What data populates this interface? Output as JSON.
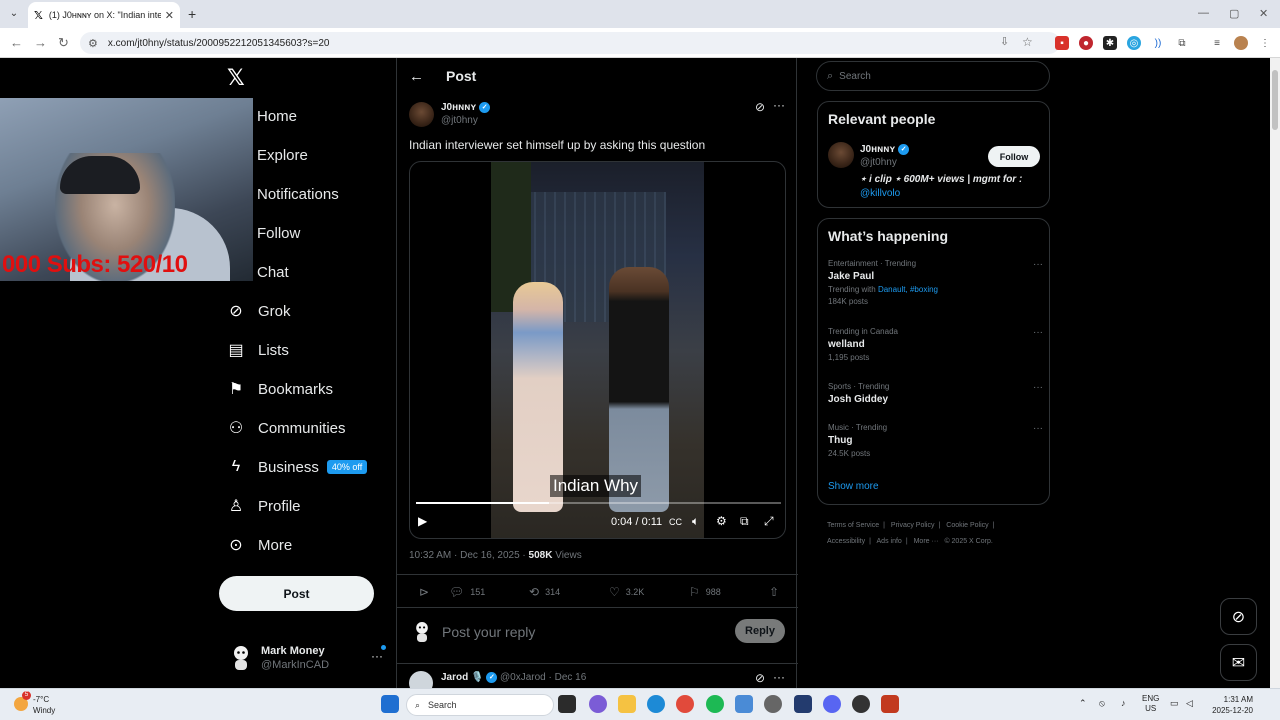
{
  "browser": {
    "tab_title": "(1) J0ʜɴɴʏ on X: \"Indian intervi",
    "tab_logo": "𝕏",
    "url": "x.com/jt0hny/status/2000952212051345603?s=20"
  },
  "webcam": {
    "overlay_text": "000 Subs: 520/10"
  },
  "nav": {
    "logo": "𝕏",
    "items": [
      {
        "label": "Home",
        "icon": ""
      },
      {
        "label": "Explore",
        "icon": ""
      },
      {
        "label": "Notifications",
        "icon": ""
      },
      {
        "label": "Follow",
        "icon": ""
      },
      {
        "label": "Chat",
        "icon": ""
      },
      {
        "label": "Grok",
        "icon": "grok-icon"
      },
      {
        "label": "Lists",
        "icon": "list-icon"
      },
      {
        "label": "Bookmarks",
        "icon": "bookmark-icon"
      },
      {
        "label": "Communities",
        "icon": "people-icon"
      },
      {
        "label": "Business",
        "icon": "lightning-icon"
      },
      {
        "label": "Profile",
        "icon": "person-icon"
      },
      {
        "label": "More",
        "icon": "more-circle-icon"
      }
    ],
    "business_badge": "40% off",
    "post_button": "Post"
  },
  "account": {
    "name": "Mark Money",
    "handle": "@MarkInCAD"
  },
  "post": {
    "header_title": "Post",
    "author_name": "J0ʜɴɴʏ",
    "author_handle": "@jt0hny",
    "text": "Indian interviewer set himself up by asking this question",
    "video": {
      "caption": "Indian Why",
      "time": "0:04 / 0:11",
      "progress": 0.364
    },
    "timestamp": "10:32 AM · Dec 16, 2025 · ",
    "views_count": "508K",
    "views_label": " Views",
    "stats": {
      "replies": "151",
      "reposts": "314",
      "likes": "3.2K",
      "bookmarks": "988"
    },
    "reply_placeholder": "Post your reply",
    "reply_button": "Reply"
  },
  "next_reply": {
    "name": "Jarod 🎙️",
    "handle": "@0xJarod · Dec 16"
  },
  "search": {
    "placeholder": "Search"
  },
  "relevant_people": {
    "title": "Relevant people",
    "name": "J0ʜɴɴʏ",
    "handle": "@jt0hny",
    "follow_label": "Follow",
    "bio": "⋆ i clip ⋆ 600M+ views | mgmt for :",
    "bio_link": "@killvolo"
  },
  "trending": {
    "title": "What’s happening",
    "items": [
      {
        "category": "Entertainment · Trending",
        "topic": "Jake Paul",
        "sub_prefix": "Trending with ",
        "sub_links": "Danault, #boxing",
        "posts": "184K posts"
      },
      {
        "category": "Trending in Canada",
        "topic": "welland",
        "posts": "1,195 posts"
      },
      {
        "category": "Sports · Trending",
        "topic": "Josh Giddey",
        "posts": ""
      },
      {
        "category": "Music · Trending",
        "topic": "Thug",
        "posts": "24.5K posts"
      }
    ],
    "show_more": "Show more"
  },
  "footer": {
    "links": [
      "Terms of Service",
      "|",
      "Privacy Policy",
      "|",
      "Cookie Policy",
      "|",
      "Accessibility",
      "|",
      "Ads info",
      "|",
      "More ···",
      "© 2025 X Corp."
    ]
  },
  "taskbar": {
    "weather_temp": "-7°C",
    "weather_desc": "Windy",
    "weather_badge": "5",
    "search_placeholder": "Search",
    "lang_top": "ENG",
    "lang_bottom": "US",
    "time": "1:31 AM",
    "date": "2025-12-20"
  },
  "colors": {
    "accent": "#1d9bf0",
    "background": "#000000",
    "border": "#2f3336",
    "muted_text": "#71767b"
  }
}
